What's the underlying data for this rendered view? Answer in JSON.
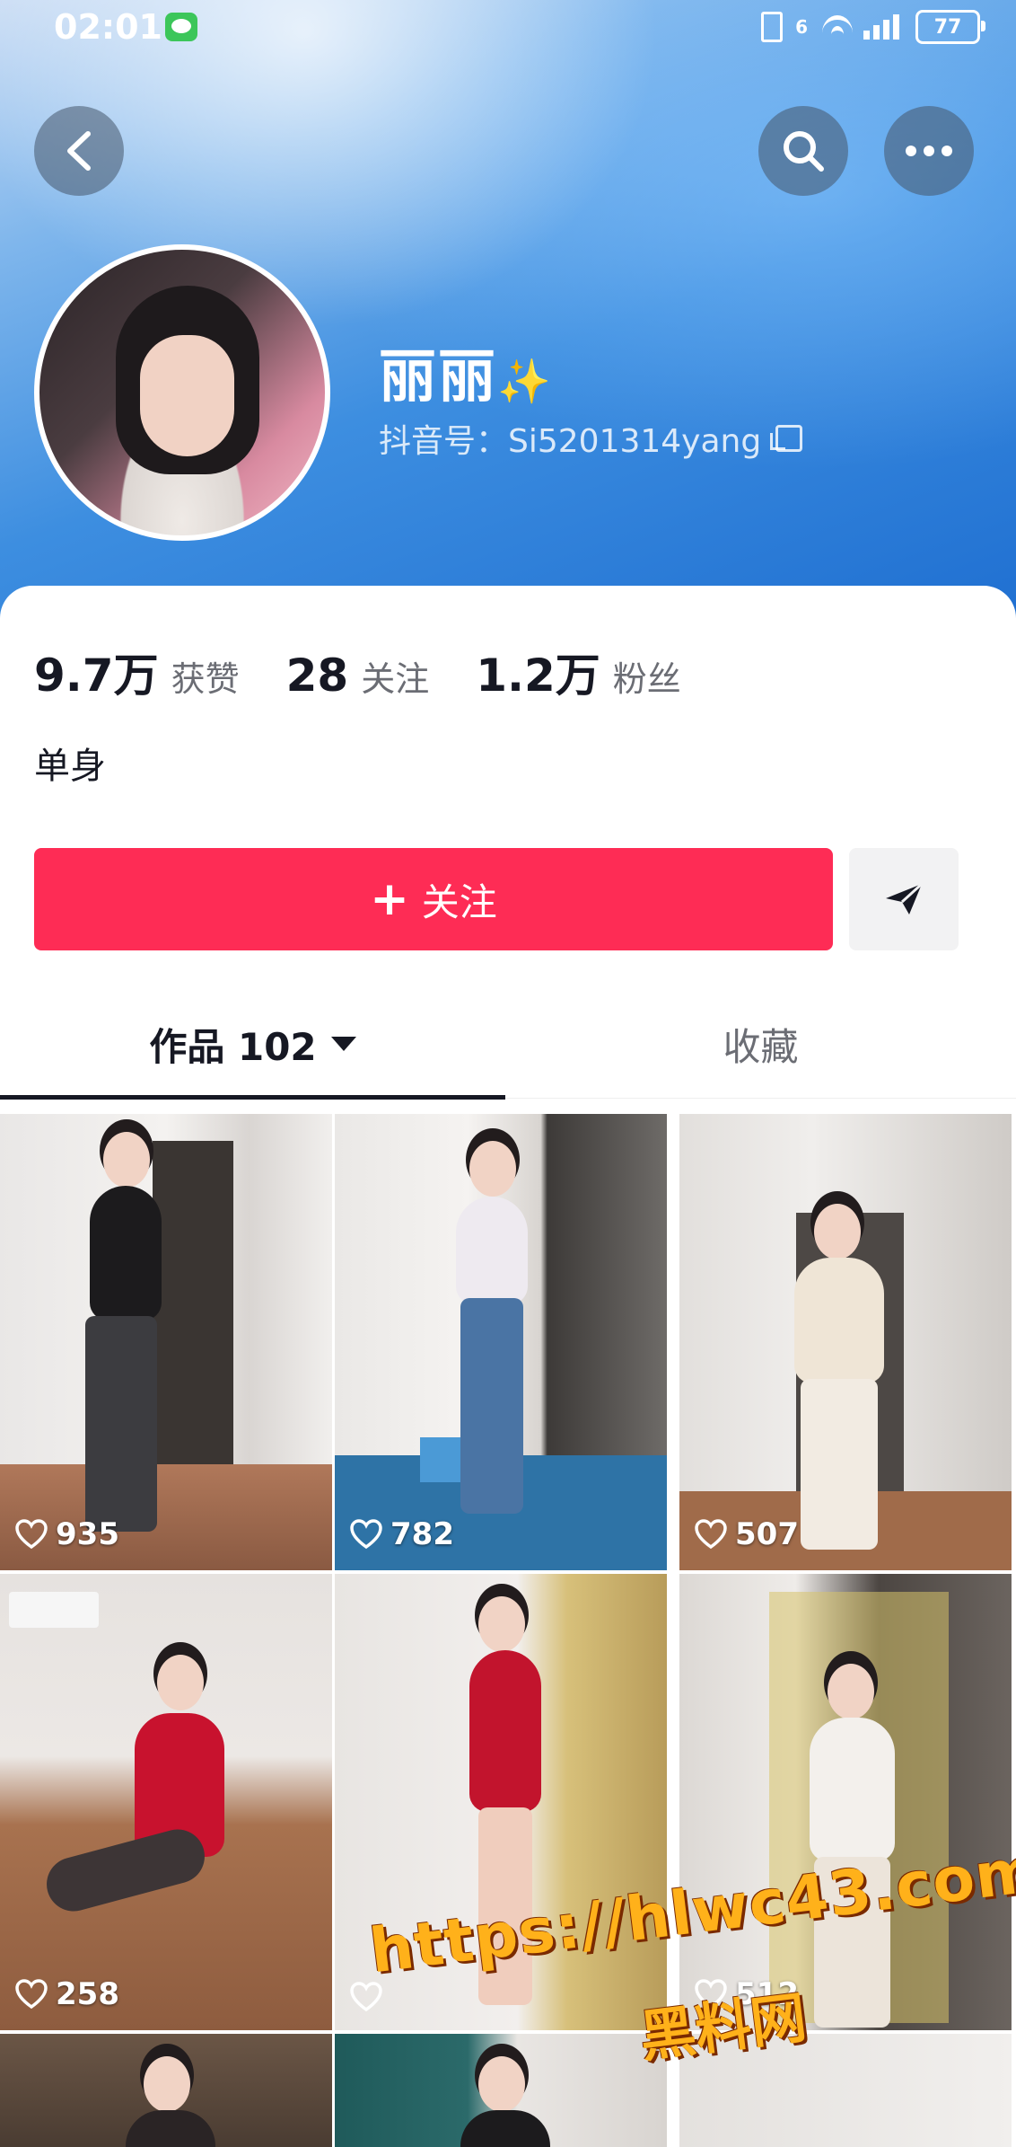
{
  "status_bar": {
    "time": "02:01",
    "network": "6",
    "battery": "77"
  },
  "profile": {
    "name": "丽丽",
    "name_emoji": "✨",
    "douyin_id": "抖音号：Si5201314yang",
    "bio": "单身"
  },
  "stats": [
    {
      "value": "9.7万",
      "label": "获赞"
    },
    {
      "value": "28",
      "label": "关注"
    },
    {
      "value": "1.2万",
      "label": "粉丝"
    }
  ],
  "follow_button": {
    "label": "关注"
  },
  "tabs": [
    {
      "label": "作品 102",
      "active": true
    },
    {
      "label": "收藏",
      "active": false
    }
  ],
  "videos": [
    {
      "likes": "935"
    },
    {
      "likes": "782"
    },
    {
      "likes": "507"
    },
    {
      "likes": "258"
    },
    {
      "likes": ""
    },
    {
      "likes": "512"
    },
    {
      "likes": ""
    },
    {
      "likes": ""
    },
    {
      "likes": ""
    }
  ],
  "watermark": {
    "url": "https://hlwc43.com",
    "name": "黑料网"
  },
  "colors": {
    "accent": "#fe2c55",
    "header_blue": "#3d8ee0",
    "text": "#161823"
  }
}
